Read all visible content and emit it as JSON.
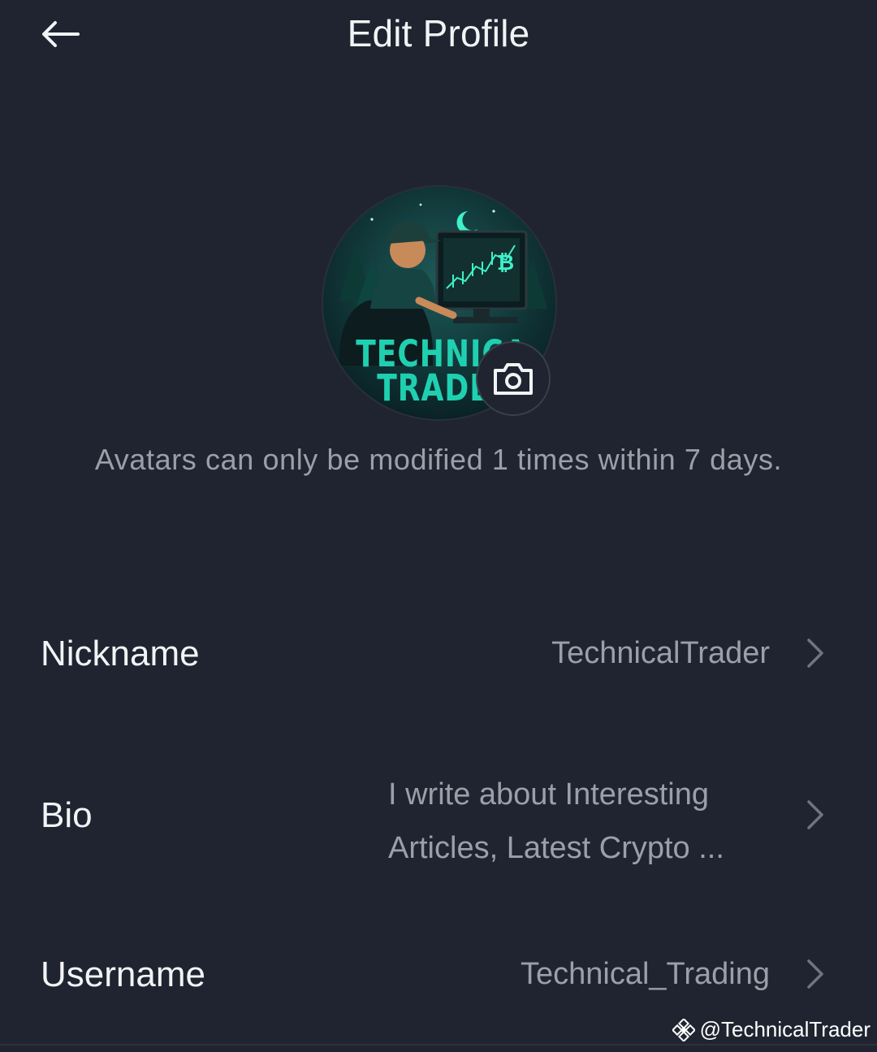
{
  "header": {
    "title": "Edit Profile",
    "back_icon": "arrow-left-icon"
  },
  "avatar": {
    "image_text_line1": "TECHNICA",
    "image_text_line2": "TRADE",
    "camera_icon": "camera-icon",
    "note": "Avatars can only be modified 1 times within 7 days."
  },
  "fields": {
    "nickname": {
      "label": "Nickname",
      "value": "TechnicalTrader"
    },
    "bio": {
      "label": "Bio",
      "value_line1": "I write about Interesting",
      "value_line2": "Articles, Latest Crypto ..."
    },
    "username": {
      "label": "Username",
      "value": "Technical_Trading"
    }
  },
  "watermark": {
    "icon": "binance-logo-icon",
    "text": "@TechnicalTrader"
  },
  "colors": {
    "background": "#1f2430",
    "primary_text": "#f2f3f5",
    "secondary_text": "#9aa0a9",
    "accent": "#1fd0b0"
  }
}
